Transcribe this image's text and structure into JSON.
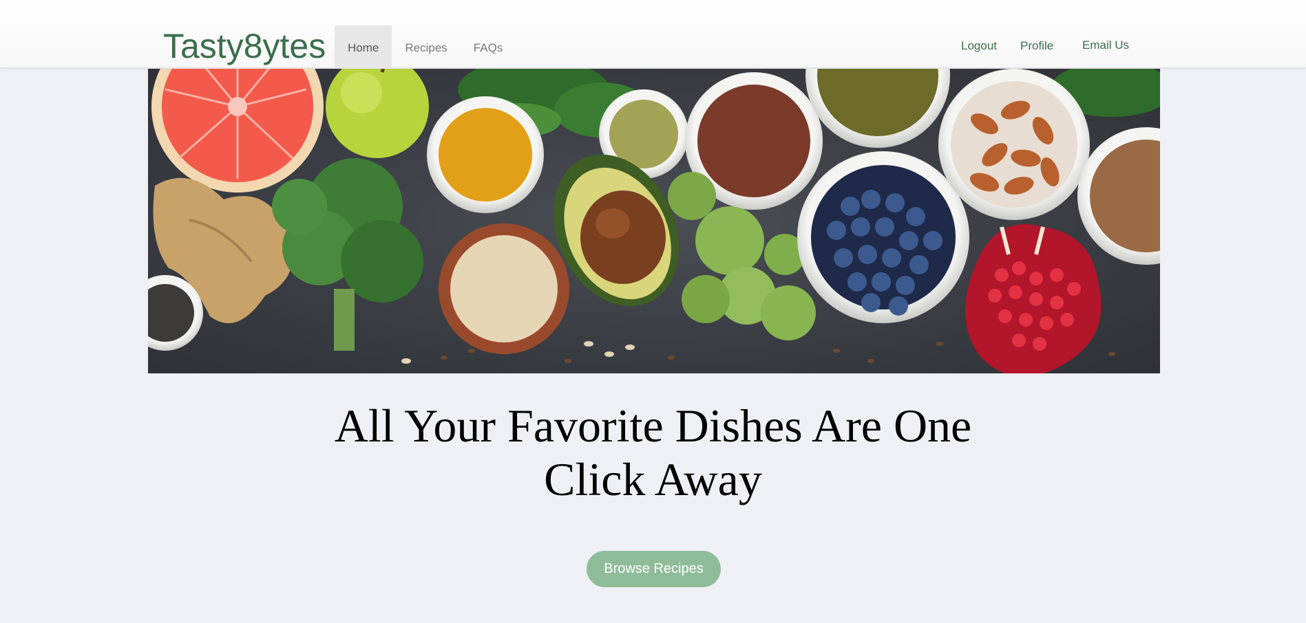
{
  "brand": {
    "name": "Tasty8ytes"
  },
  "nav": {
    "left": [
      {
        "label": "Home",
        "active": true
      },
      {
        "label": "Recipes",
        "active": false
      },
      {
        "label": "FAQs",
        "active": false
      }
    ],
    "right": [
      {
        "label": "Logout"
      },
      {
        "label": "Profile"
      },
      {
        "label": "Email Us"
      }
    ]
  },
  "hero": {
    "image": "healthy-food-flatlay"
  },
  "headline": {
    "line1": "All Your Favorite Dishes Are One",
    "line2": "Click Away"
  },
  "cta": {
    "label": "Browse Recipes"
  },
  "colors": {
    "brand": "#3b6e4c",
    "page_bg": "#eff0f5",
    "cta_bg": "#8fbc98",
    "active_tab_bg": "#e7e7e7"
  }
}
